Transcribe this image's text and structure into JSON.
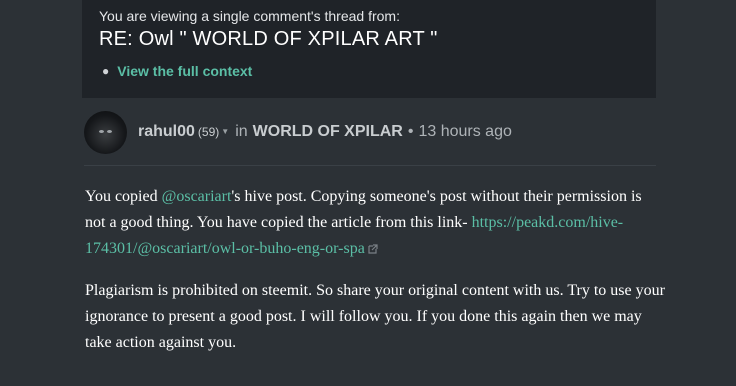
{
  "context": {
    "intro": "You are viewing a single comment's thread from:",
    "title": "RE: Owl \" WORLD OF XPILAR ART \"",
    "link_label": "View the full context"
  },
  "author": {
    "name": "rahul00",
    "reputation": "(59)",
    "in_label": "in",
    "community": "WORLD OF XPILAR",
    "separator": "•",
    "time": "13 hours ago"
  },
  "comment": {
    "p1_before": "You copied ",
    "p1_mention": "@oscariart",
    "p1_after": "'s hive post. Copying someone's post without their permission is not a good thing. You have copied the article from this link-",
    "p1_link": "https://peakd.com/hive-174301/@oscariart/owl-or-buho-eng-or-spa",
    "p2": "Plagiarism is prohibited on steemit. So share your original content with us. Try to use your ignorance to present a good post. I will follow you. If you done this again then we may take action against you."
  },
  "colors": {
    "accent": "#5bbfa6",
    "background": "#2c3136",
    "context_bg": "#1f2328"
  },
  "icons": [
    "bullet-icon",
    "caret-down-icon",
    "external-link-icon"
  ]
}
